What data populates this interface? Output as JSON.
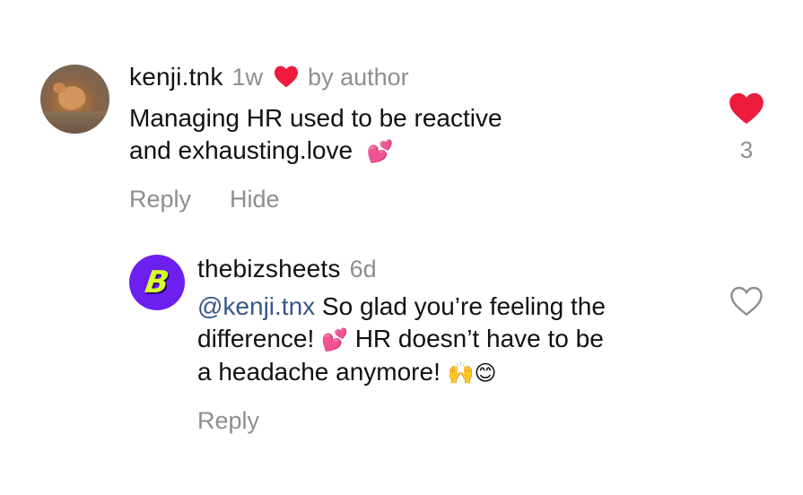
{
  "comment": {
    "username": "kenji.tnk",
    "time": "1w",
    "author_like": "by author",
    "text_line1": "Managing HR used to be reactive",
    "text_line2": "and exhausting.love",
    "emoji_1": "💕",
    "reply_label": "Reply",
    "hide_label": "Hide",
    "like_count": "3",
    "liked": true,
    "heart_color": "#ed1c3c"
  },
  "reply": {
    "username": "thebizsheets",
    "time": "6d",
    "mention": "@kenji.tnx",
    "text_line1": " So glad you’re feeling the",
    "text_line2a": "difference! ",
    "emoji_1": "💕",
    "text_line2b": " HR doesn’t have to be",
    "text_line3": "a headache anymore! ",
    "emoji_2": "🙌😊",
    "reply_label": "Reply",
    "liked": false,
    "avatar_letter": "B",
    "avatar_bg": "#6d1ff0",
    "avatar_fg": "#d8ff2a"
  }
}
